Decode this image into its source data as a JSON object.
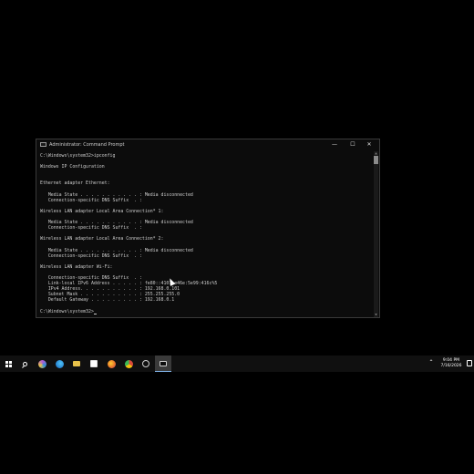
{
  "window": {
    "title": "Administrator: Command Prompt",
    "minimize_glyph": "—",
    "maximize_glyph": "☐",
    "close_glyph": "✕",
    "icon": "cmd-icon"
  },
  "console": {
    "lines": [
      "C:\\Windows\\system32>ipconfig",
      "",
      "Windows IP Configuration",
      "",
      "",
      "Ethernet adapter Ethernet:",
      "",
      "   Media State . . . . . . . . . . . : Media disconnected",
      "   Connection-specific DNS Suffix  . :",
      "",
      "Wireless LAN adapter Local Area Connection* 1:",
      "",
      "   Media State . . . . . . . . . . . : Media disconnected",
      "   Connection-specific DNS Suffix  . :",
      "",
      "Wireless LAN adapter Local Area Connection* 2:",
      "",
      "   Media State . . . . . . . . . . . : Media disconnected",
      "   Connection-specific DNS Suffix  . :",
      "",
      "Wireless LAN adapter Wi-Fi:",
      "",
      "   Connection-specific DNS Suffix  . :",
      "   Link-local IPv6 Address . . . . . : fe80::4101:e46e:5e99:416c%5",
      "   IPv4 Address. . . . . . . . . . . : 192.168.0.101",
      "   Subnet Mask . . . . . . . . . . . : 255.255.255.0",
      "   Default Gateway . . . . . . . . . : 192.168.0.1",
      "",
      "C:\\Windows\\system32>"
    ]
  },
  "taskbar": {
    "items": [
      {
        "name": "start-button",
        "icon": "windows-logo-icon"
      },
      {
        "name": "search-button",
        "icon": "search-icon"
      },
      {
        "name": "taskbar-app-1",
        "icon": "colorful-app-icon",
        "color": "#b25bd6"
      },
      {
        "name": "taskbar-app-edge",
        "icon": "edge-icon",
        "color": "#2f8fd8"
      },
      {
        "name": "taskbar-app-files",
        "icon": "folder-icon",
        "color": "#e8c24a"
      },
      {
        "name": "taskbar-app-store",
        "icon": "store-icon",
        "color": "#ffffff"
      },
      {
        "name": "taskbar-app-firefox",
        "icon": "firefox-icon",
        "color": "#e8702a"
      },
      {
        "name": "taskbar-app-chrome",
        "icon": "chrome-icon",
        "color": "#d94a3a"
      },
      {
        "name": "taskbar-app-gear",
        "icon": "app-circle-icon",
        "color": "#cfcfcf"
      },
      {
        "name": "taskbar-app-cmd",
        "icon": "cmd-icon",
        "color": "#cfcfcf",
        "active": true
      }
    ],
    "tray": {
      "time": "9:04 PM",
      "date": "7/16/2026"
    }
  },
  "colors": {
    "console_bg": "#0c0c0c",
    "console_text": "#cccccc",
    "taskbar_bg": "#101010"
  }
}
